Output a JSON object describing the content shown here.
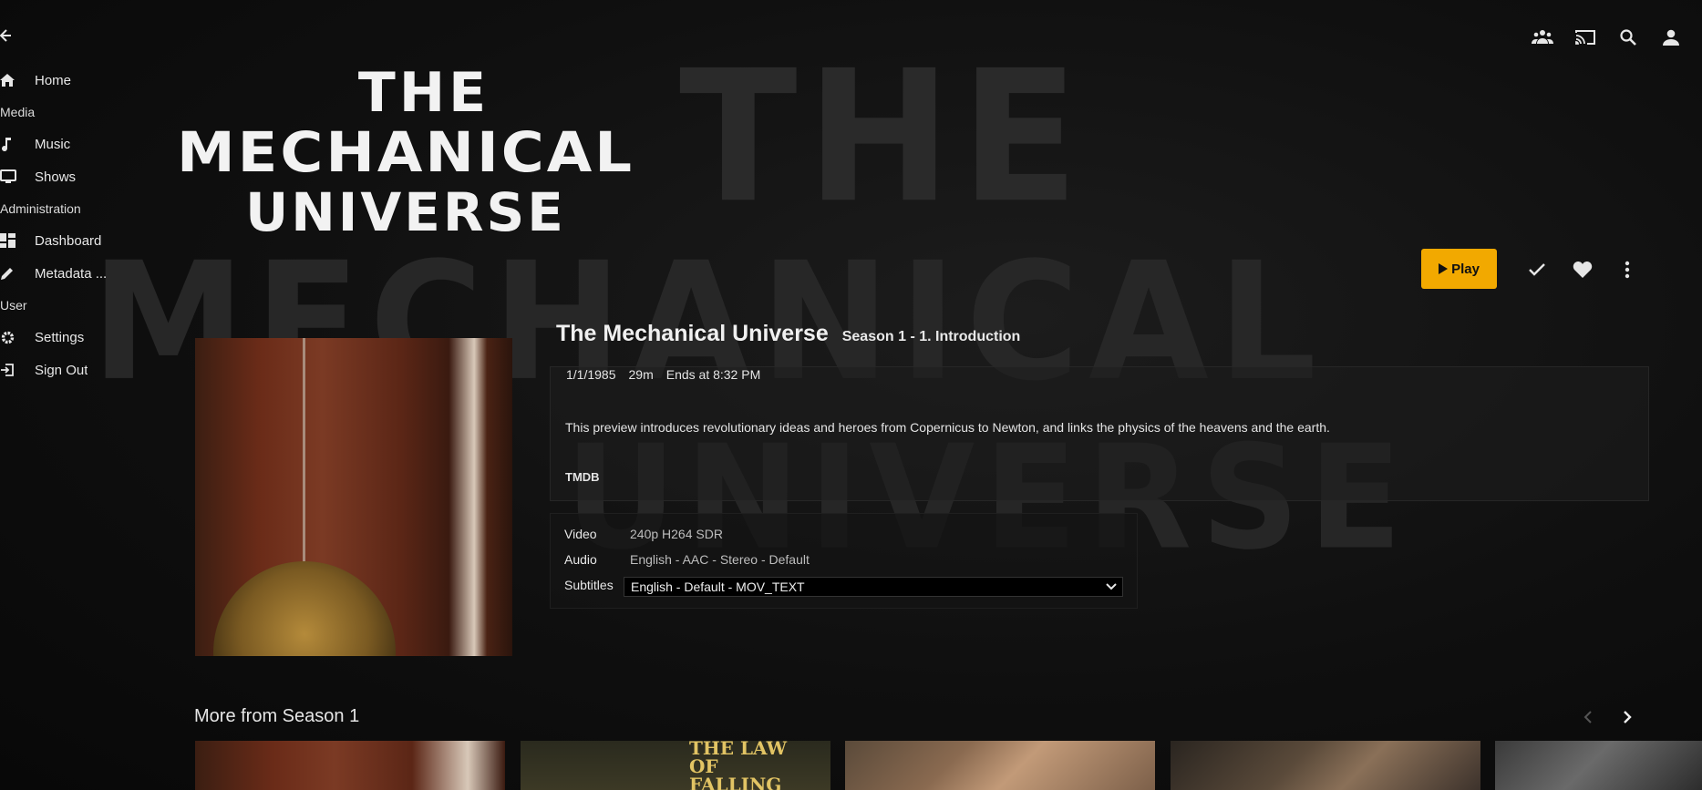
{
  "sidebar": {
    "items": [
      {
        "label": "Home",
        "icon": "home-icon"
      },
      {
        "section": "Media"
      },
      {
        "label": "Music",
        "icon": "music-note-icon"
      },
      {
        "label": "Shows",
        "icon": "tv-icon"
      },
      {
        "section": "Administration"
      },
      {
        "label": "Dashboard",
        "icon": "dashboard-icon"
      },
      {
        "label": "Metadata ...",
        "icon": "pencil-icon"
      },
      {
        "section": "User"
      },
      {
        "label": "Settings",
        "icon": "gear-icon"
      },
      {
        "label": "Sign Out",
        "icon": "sign-out-icon"
      }
    ]
  },
  "header": {
    "icons": [
      "sync-play-icon",
      "cast-icon",
      "search-icon",
      "user-icon"
    ]
  },
  "logo": {
    "line1": "THE",
    "line2": "MECHANICAL",
    "line3": "UNIVERSE"
  },
  "backdrop": {
    "line1": "THE",
    "line2": "MECHANICAL",
    "line3": "UNIVERSE"
  },
  "actions": {
    "play_label": "Play",
    "icons": [
      "check-icon",
      "heart-icon",
      "more-vertical-icon"
    ],
    "accent_color": "#f2a900"
  },
  "item": {
    "title": "The Mechanical Universe",
    "subtitle": "Season 1 - 1. Introduction",
    "date": "1/1/1985",
    "runtime": "29m",
    "ends_at": "Ends at 8:32 PM",
    "overview": "This preview introduces revolutionary ideas and heroes from Copernicus to Newton, and links the physics of the heavens and the earth.",
    "provider": "TMDB"
  },
  "media": {
    "video_label": "Video",
    "video_value": "240p H264 SDR",
    "audio_label": "Audio",
    "audio_value": "English - AAC - Stereo - Default",
    "subtitles_label": "Subtitles",
    "subtitles_value": "English - Default - MOV_TEXT"
  },
  "more": {
    "title": "More from Season 1",
    "card2_text_line1": "THE LAW",
    "card2_text_line2": "OF",
    "card2_text_line3": "FALLING"
  }
}
